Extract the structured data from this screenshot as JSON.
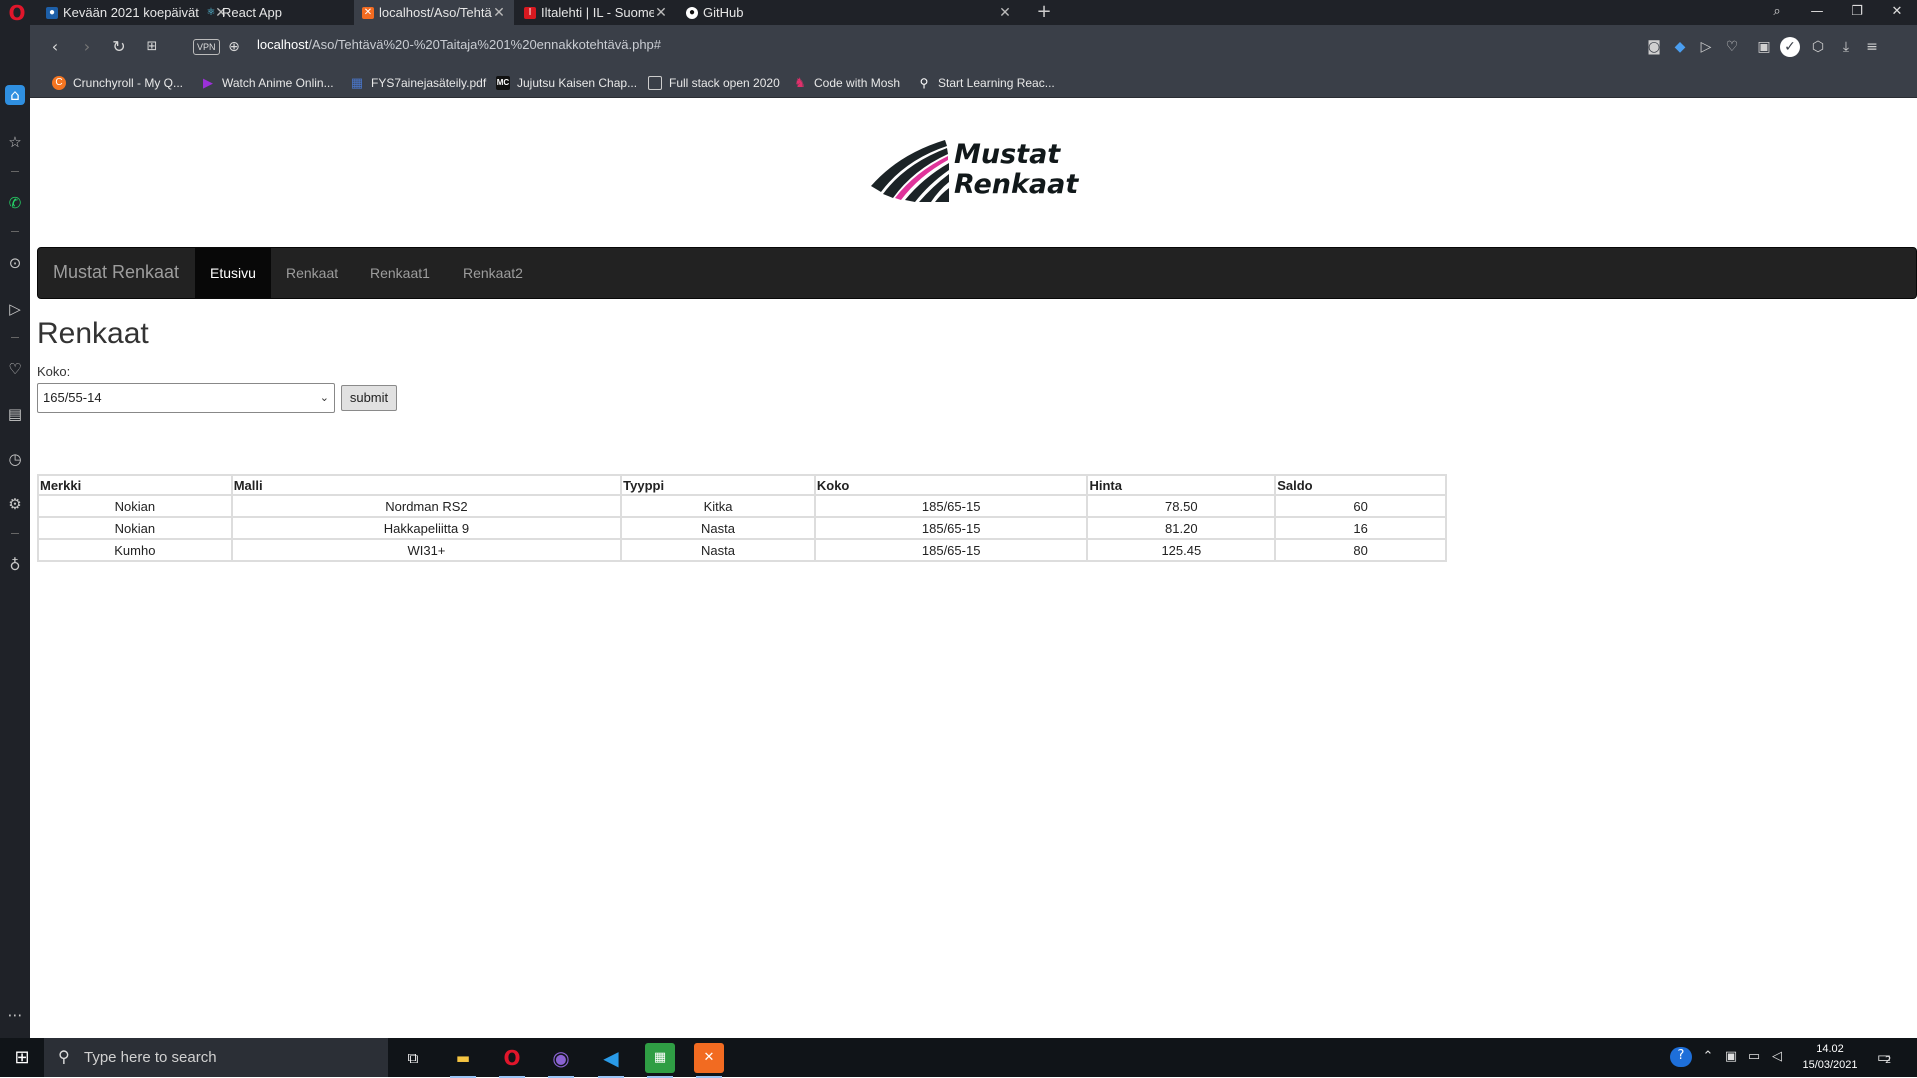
{
  "browser": {
    "tabs": [
      {
        "label": "Kevään 2021 koepäivät",
        "active": false
      },
      {
        "label": "React App",
        "active": false
      },
      {
        "label": "localhost/Aso/Tehtävä - Tai",
        "active": true
      },
      {
        "label": "Iltalehti | IL - Suomen nope",
        "active": false
      },
      {
        "label": "GitHub",
        "active": false
      }
    ],
    "vpn": "VPN",
    "url_host": "localhost",
    "url_path": "/Aso/Tehtävä%20-%20Taitaja%201%20ennakkotehtävä.php#",
    "bookmarks": [
      {
        "label": "Crunchyroll - My Q...",
        "icon": "crunchyroll-icon",
        "color": "#f47521"
      },
      {
        "label": "Watch Anime Onlin...",
        "icon": "play-triangle-icon",
        "color": "#9b30d9"
      },
      {
        "label": "FYS7ainejasäteily.pdf",
        "icon": "pdf-icon",
        "color": "#4a76c9"
      },
      {
        "label": "Jujutsu Kaisen Chap...",
        "icon": "mc-icon",
        "color": "#111111"
      },
      {
        "label": "Full stack open 2020",
        "icon": "square-icon",
        "color": "#3a3f48"
      },
      {
        "label": "Code with Mosh",
        "icon": "mosh-icon",
        "color": "#e0306b"
      },
      {
        "label": "Start Learning Reac...",
        "icon": "lock-icon",
        "color": "#3a3f48"
      }
    ]
  },
  "site": {
    "logo_line1": "Mustat",
    "logo_line2": "Renkaat",
    "brand": "Mustat Renkaat",
    "nav": [
      {
        "label": "Etusivu",
        "active": true
      },
      {
        "label": "Renkaat",
        "active": false
      },
      {
        "label": "Renkaat1",
        "active": false
      },
      {
        "label": "Renkaat2",
        "active": false
      }
    ],
    "title": "Renkaat",
    "koko_label": "Koko:",
    "koko_selected": "165/55-14",
    "submit_label": "submit",
    "table": {
      "headers": [
        "Merkki",
        "Malli",
        "Tyyppi",
        "Koko",
        "Hinta",
        "Saldo"
      ],
      "rows": [
        [
          "Nokian",
          "Nordman RS2",
          "Kitka",
          "185/65-15",
          "78.50",
          "60"
        ],
        [
          "Nokian",
          "Hakkapeliitta 9",
          "Nasta",
          "185/65-15",
          "81.20",
          "16"
        ],
        [
          "Kumho",
          "WI31+",
          "Nasta",
          "185/65-15",
          "125.45",
          "80"
        ]
      ]
    }
  },
  "taskbar": {
    "search_placeholder": "Type here to search",
    "time": "14.02",
    "date": "15/03/2021",
    "notification_count": "2"
  },
  "colors": {
    "navbar": "#222222",
    "navbar_active": "#080808",
    "accent_opera": "#e0162b",
    "logo_stripe_pink": "#e0349b"
  }
}
